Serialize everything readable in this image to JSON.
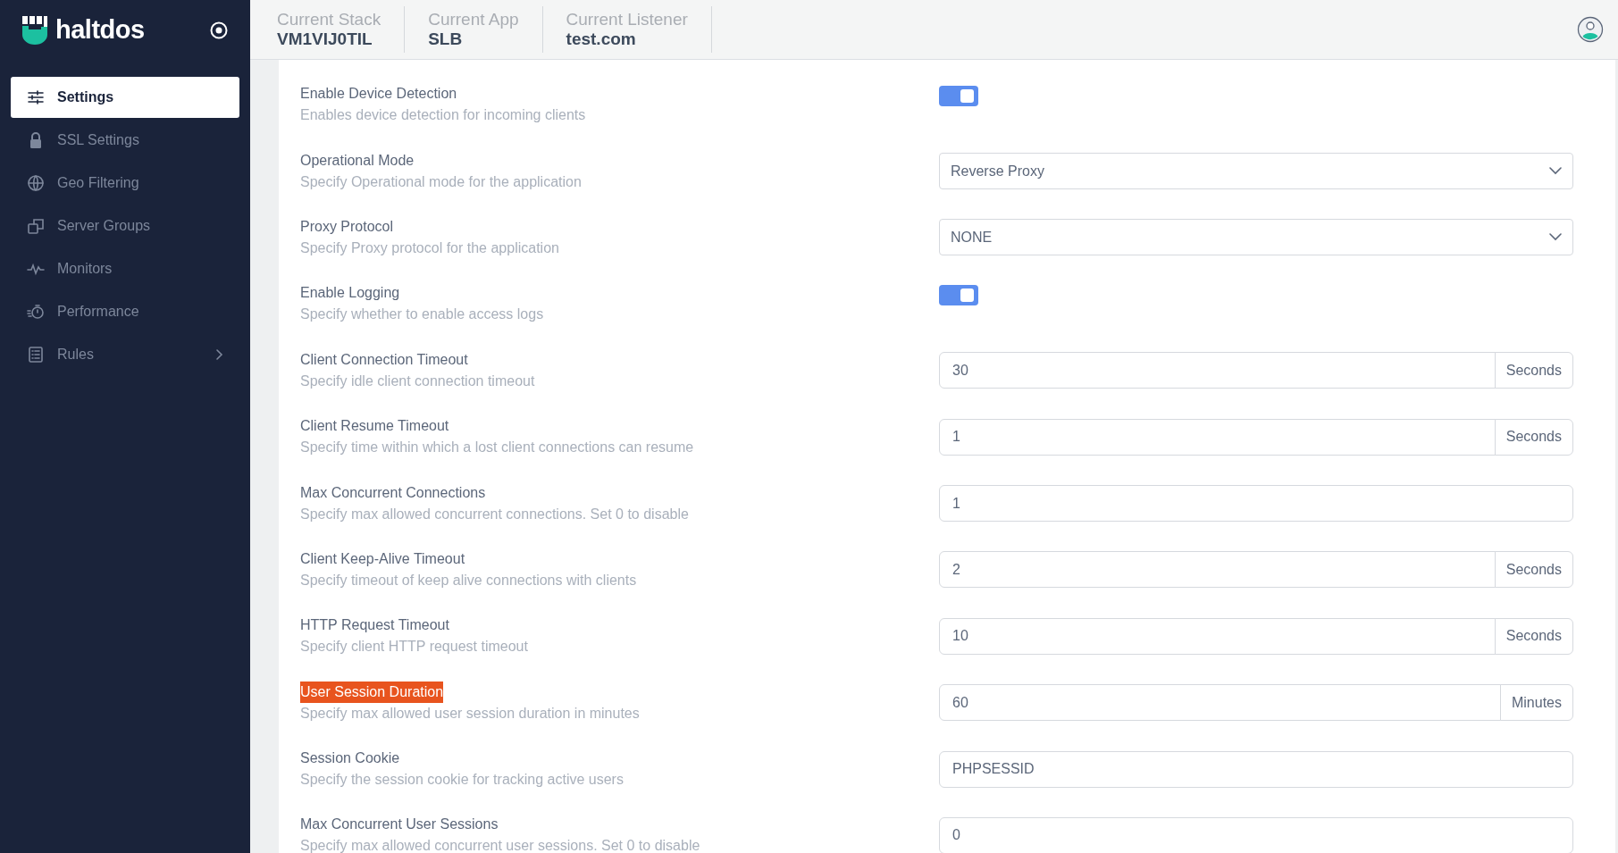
{
  "sidebar": {
    "logo": "haltdos",
    "items": [
      {
        "label": "Settings",
        "selected": true,
        "has_submenu": false
      },
      {
        "label": "SSL Settings",
        "selected": false,
        "has_submenu": false
      },
      {
        "label": "Geo Filtering",
        "selected": false,
        "has_submenu": false
      },
      {
        "label": "Server Groups",
        "selected": false,
        "has_submenu": false
      },
      {
        "label": "Monitors",
        "selected": false,
        "has_submenu": false
      },
      {
        "label": "Performance",
        "selected": false,
        "has_submenu": false
      },
      {
        "label": "Rules",
        "selected": false,
        "has_submenu": true
      }
    ]
  },
  "header": {
    "fields": [
      {
        "label": "Current Stack",
        "value": "VM1VIJ0TIL"
      },
      {
        "label": "Current App",
        "value": "SLB"
      },
      {
        "label": "Current Listener",
        "value": "test.com"
      }
    ]
  },
  "settings": [
    {
      "kind": "toggle",
      "label": "Enable Device Detection",
      "description": "Enables device detection for incoming clients",
      "on": true,
      "highlighted": false
    },
    {
      "kind": "select",
      "label": "Operational Mode",
      "description": "Specify Operational mode for the application",
      "value": "Reverse Proxy",
      "highlighted": false
    },
    {
      "kind": "select",
      "label": "Proxy Protocol",
      "description": "Specify Proxy protocol for the application",
      "value": "NONE",
      "highlighted": false
    },
    {
      "kind": "toggle",
      "label": "Enable Logging",
      "description": "Specify whether to enable access logs",
      "on": true,
      "highlighted": false
    },
    {
      "kind": "input",
      "label": "Client Connection Timeout",
      "description": "Specify idle client connection timeout",
      "value": "30",
      "unit": "Seconds",
      "highlighted": false
    },
    {
      "kind": "input",
      "label": "Client Resume Timeout",
      "description": "Specify time within which a lost client connections can resume",
      "value": "1",
      "unit": "Seconds",
      "highlighted": false
    },
    {
      "kind": "input",
      "label": "Max Concurrent Connections",
      "description": "Specify max allowed concurrent connections. Set 0 to disable",
      "value": "1",
      "highlighted": false
    },
    {
      "kind": "input",
      "label": "Client Keep-Alive Timeout",
      "description": "Specify timeout of keep alive connections with clients",
      "value": "2",
      "unit": "Seconds",
      "highlighted": false
    },
    {
      "kind": "input",
      "label": "HTTP Request Timeout",
      "description": "Specify client HTTP request timeout",
      "value": "10",
      "unit": "Seconds",
      "highlighted": false
    },
    {
      "kind": "input",
      "label": "User Session Duration",
      "description": "Specify max allowed user session duration in minutes",
      "value": "60",
      "unit": "Minutes",
      "highlighted": true
    },
    {
      "kind": "input",
      "label": "Session Cookie",
      "description": "Specify the session cookie for tracking active users",
      "value": "PHPSESSID",
      "highlighted": false
    },
    {
      "kind": "input",
      "label": "Max Concurrent User Sessions",
      "description": "Specify max allowed concurrent user sessions. Set 0 to disable",
      "value": "0",
      "highlighted": false
    }
  ]
}
